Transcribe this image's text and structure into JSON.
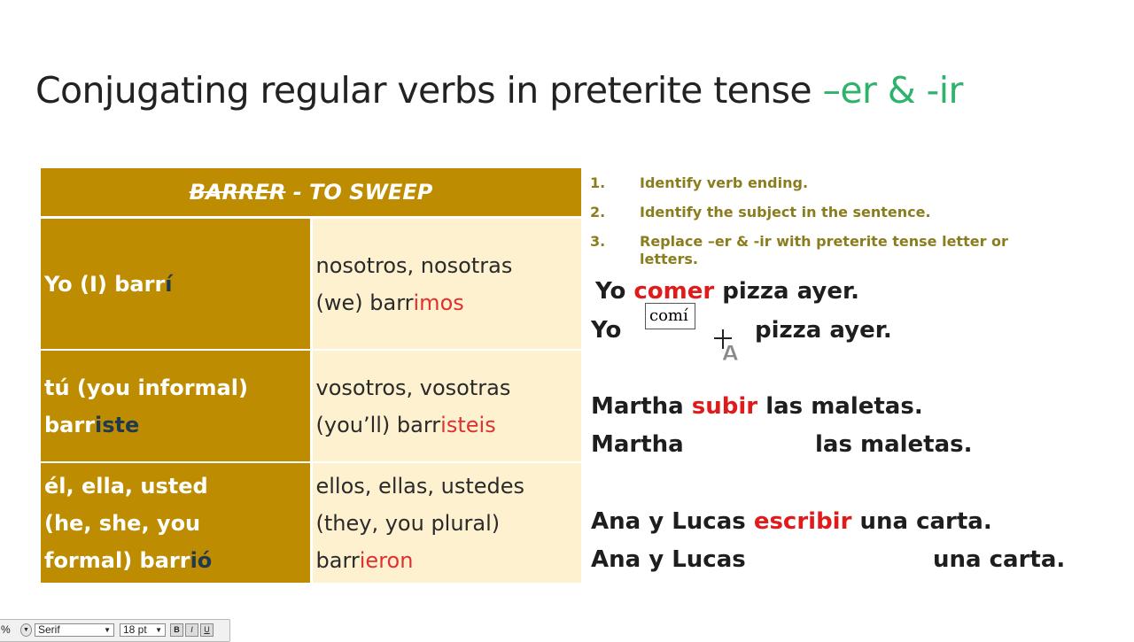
{
  "title": {
    "main": "Conjugating regular verbs in preterite tense ",
    "accent": "–er & -ir"
  },
  "table": {
    "header": {
      "strike_part": "BARRER",
      "rest": " - TO SWEEP"
    },
    "rows": [
      {
        "left": [
          {
            "line": [
              {
                "text": "Yo (I) barr"
              },
              {
                "text": "í",
                "style": "dark"
              }
            ]
          }
        ],
        "right": [
          {
            "line": [
              {
                "text": "nosotros, nosotras"
              }
            ]
          },
          {
            "line": [
              {
                "text": "(we) barr"
              },
              {
                "text": "imos",
                "style": "red"
              }
            ]
          }
        ]
      },
      {
        "left": [
          {
            "line": [
              {
                "text": "tú (you informal)"
              }
            ]
          },
          {
            "line": [
              {
                "text": "barr"
              },
              {
                "text": "iste",
                "style": "dark"
              }
            ]
          }
        ],
        "right": [
          {
            "line": [
              {
                "text": "vosotros, vosotras"
              }
            ]
          },
          {
            "line": [
              {
                "text": "(you’ll) barr"
              },
              {
                "text": "isteis",
                "style": "red"
              }
            ]
          }
        ]
      },
      {
        "left": [
          {
            "line": [
              {
                "text": "él, ella, usted"
              }
            ]
          },
          {
            "line": [
              {
                "text": "(he, she, you"
              }
            ]
          },
          {
            "line": [
              {
                "text": "formal) barr"
              },
              {
                "text": "ió",
                "style": "dark"
              }
            ]
          }
        ],
        "right": [
          {
            "line": [
              {
                "text": "ellos, ellas, ustedes"
              }
            ]
          },
          {
            "line": [
              {
                "text": "(they, you plural)"
              }
            ]
          },
          {
            "line": [
              {
                "text": "barr"
              },
              {
                "text": "ieron",
                "style": "red"
              }
            ]
          }
        ]
      }
    ]
  },
  "steps": [
    {
      "num": "1.",
      "text": "Identify verb ending."
    },
    {
      "num": "2.",
      "text": "Identify the subject in the sentence."
    },
    {
      "num": "3.",
      "text": "Replace –er & -ir with preterite tense letter or letters."
    }
  ],
  "sentences": {
    "s1": {
      "subject": "Yo",
      "verb": "comer",
      "rest": "pizza ayer."
    },
    "s1_answer": {
      "subject": "Yo",
      "rest": "pizza ayer."
    },
    "s2": {
      "subject": "Martha",
      "verb": "subir",
      "rest": "las maletas."
    },
    "s2_answer": {
      "subject": "Martha",
      "rest": "las maletas."
    },
    "s3": {
      "subject": "Ana y Lucas",
      "verb": "escribir",
      "rest": "una carta."
    },
    "s3_answer": {
      "subject": "Ana y Lucas",
      "rest": "una carta."
    }
  },
  "answer_box": {
    "value": "comí"
  },
  "toolbar": {
    "zoom": "%",
    "font": "Serif",
    "size": "18 pt",
    "bold": "B",
    "italic": "I",
    "underline": "U"
  },
  "colors": {
    "gold": "#bd8c00",
    "cream": "#fdf1cf",
    "red": "#e01b1b",
    "green": "#2db36b",
    "olive": "#8a7d1e"
  }
}
